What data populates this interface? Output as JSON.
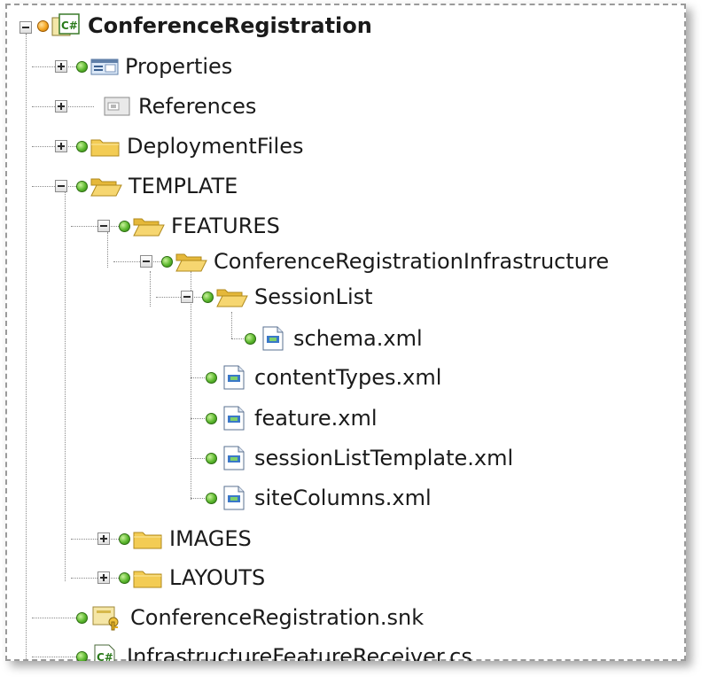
{
  "tree": {
    "root": {
      "label": "ConferenceRegistration",
      "icon": "csharp-project-icon",
      "expanded": true
    },
    "items": [
      {
        "label": "Properties",
        "icon": "properties-icon",
        "expanded": false
      },
      {
        "label": "References",
        "icon": "references-icon",
        "expanded": false
      },
      {
        "label": "DeploymentFiles",
        "icon": "folder-icon",
        "expanded": false
      },
      {
        "label": "TEMPLATE",
        "icon": "folder-open-icon",
        "expanded": true
      },
      {
        "label": "FEATURES",
        "icon": "folder-open-icon",
        "expanded": true
      },
      {
        "label": "ConferenceRegistrationInfrastructure",
        "icon": "folder-open-icon",
        "expanded": true
      },
      {
        "label": "SessionList",
        "icon": "folder-open-icon",
        "expanded": true
      },
      {
        "label": "schema.xml",
        "icon": "xml-file-icon"
      },
      {
        "label": "contentTypes.xml",
        "icon": "xml-file-icon"
      },
      {
        "label": "feature.xml",
        "icon": "xml-file-icon"
      },
      {
        "label": "sessionListTemplate.xml",
        "icon": "xml-file-icon"
      },
      {
        "label": "siteColumns.xml",
        "icon": "xml-file-icon"
      },
      {
        "label": "IMAGES",
        "icon": "folder-icon",
        "expanded": false
      },
      {
        "label": "LAYOUTS",
        "icon": "folder-icon",
        "expanded": false
      },
      {
        "label": "ConferenceRegistration.snk",
        "icon": "key-file-icon"
      },
      {
        "label": "InfrastructureFeatureReceiver.cs",
        "icon": "csharp-file-icon"
      }
    ]
  },
  "colors": {
    "source_control_dot": "#5cb82e",
    "root_dot": "#f5a623",
    "folder": "#f3cc54",
    "text": "#1a1a1a"
  }
}
